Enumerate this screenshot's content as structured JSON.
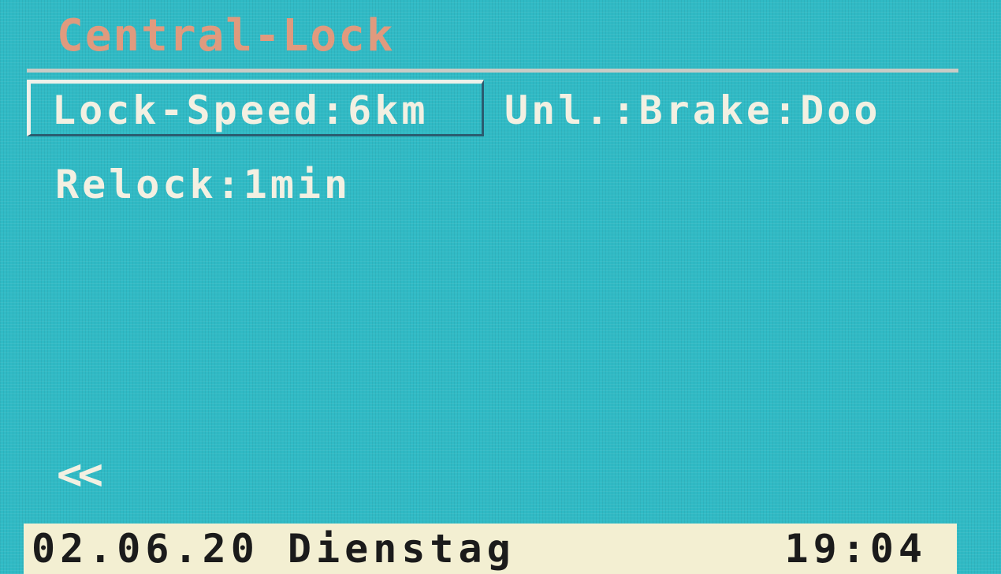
{
  "header": {
    "title": "Central-Lock"
  },
  "menu": {
    "lock_speed": "Lock-Speed:6km",
    "unlock": "Unl.:Brake:Doo",
    "relock": "Relock:1min"
  },
  "nav": {
    "back_label": "<<"
  },
  "status_bar": {
    "date_day": "02.06.20 Dienstag",
    "time": "19:04"
  },
  "colors": {
    "screen_background": "#30bac5",
    "title_text": "#e09a7e",
    "menu_text": "#f3f0e2",
    "status_bar_background": "#f3efd2",
    "status_bar_text": "#1b1b1b"
  }
}
